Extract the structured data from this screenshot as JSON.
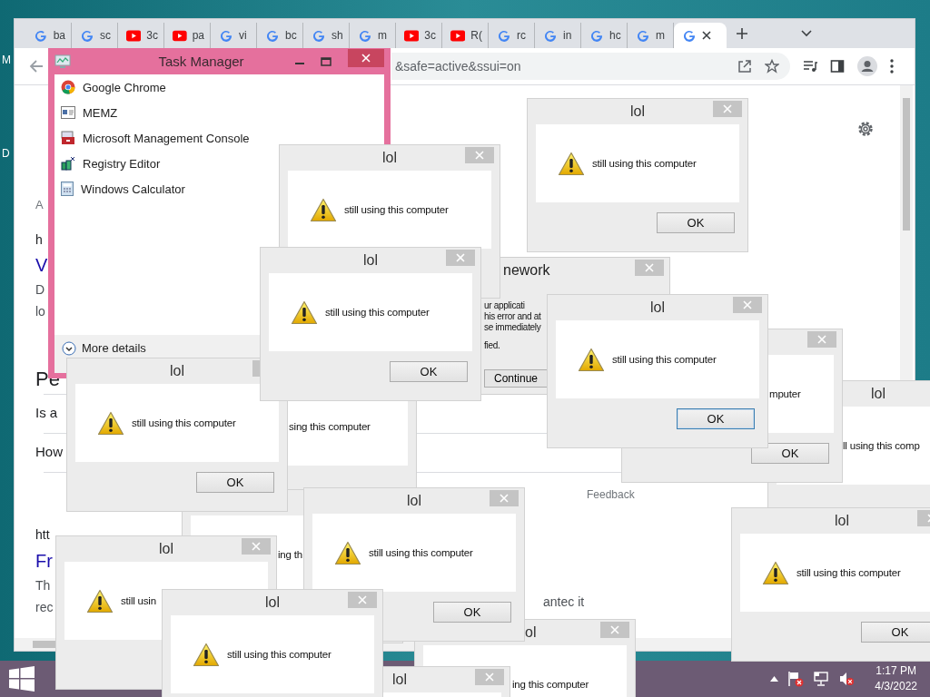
{
  "desktop": {
    "icon_labels": [
      "M",
      "D"
    ]
  },
  "browser": {
    "tabs": [
      {
        "label": "ba",
        "kind": "google",
        "selected": false
      },
      {
        "label": "sc",
        "kind": "google",
        "selected": false
      },
      {
        "label": "3c",
        "kind": "video",
        "selected": false
      },
      {
        "label": "pa",
        "kind": "video",
        "selected": false
      },
      {
        "label": "vi",
        "kind": "google",
        "selected": false
      },
      {
        "label": "bc",
        "kind": "google",
        "selected": false
      },
      {
        "label": "sh",
        "kind": "google",
        "selected": false
      },
      {
        "label": "m",
        "kind": "google",
        "selected": false
      },
      {
        "label": "3c",
        "kind": "video",
        "selected": false
      },
      {
        "label": "R(",
        "kind": "video",
        "selected": false
      },
      {
        "label": "rc",
        "kind": "google",
        "selected": false
      },
      {
        "label": "in",
        "kind": "google",
        "selected": false
      },
      {
        "label": "hc",
        "kind": "google",
        "selected": false
      },
      {
        "label": "m",
        "kind": "google",
        "selected": false
      },
      {
        "kind": "google",
        "selected": true
      }
    ],
    "address": "&safe=active&ssui=on",
    "page": {
      "fragments": [
        {
          "kind": "meta",
          "text": "A"
        },
        {
          "kind": "url",
          "text": "h"
        },
        {
          "kind": "title",
          "text": "V"
        },
        {
          "kind": "snippet",
          "text": "D"
        },
        {
          "kind": "snippet",
          "text": "lo"
        },
        {
          "kind": "heading",
          "text": "Pe"
        },
        {
          "kind": "question",
          "text": "Is a"
        },
        {
          "kind": "question",
          "text": "How"
        },
        {
          "kind": "url",
          "text": "htt"
        },
        {
          "kind": "title",
          "text": "Fr"
        },
        {
          "kind": "snippet",
          "text": "Th"
        },
        {
          "kind": "snippet",
          "text": "rec"
        }
      ],
      "feedback": "Feedback",
      "snippet_tail": "antec it"
    }
  },
  "task_manager": {
    "title": "Task Manager",
    "apps": [
      {
        "name": "Google Chrome",
        "kind": "chrome"
      },
      {
        "name": "MEMZ",
        "kind": "app"
      },
      {
        "name": "Microsoft Management Console",
        "kind": "console"
      },
      {
        "name": "Registry Editor",
        "kind": "registry"
      },
      {
        "name": "Windows Calculator",
        "kind": "calculator"
      }
    ],
    "more_details": "More details"
  },
  "error_dialog": {
    "title": "nework",
    "paragraphs": [
      [
        "ur applicati",
        "his error and at",
        "se immediately"
      ],
      [
        "fied."
      ]
    ],
    "button": "Continue"
  },
  "dialogs": [
    {
      "title": "lol",
      "message": "still using this computer",
      "icon": true,
      "button": "OK",
      "focused": false
    },
    {
      "title": "lol",
      "message": "still using this computer",
      "icon": true
    },
    {
      "title": "lol",
      "message": "still using this computer",
      "icon": true,
      "button": "OK",
      "focused": false
    },
    {
      "title": "lol",
      "message": "still using this computer",
      "icon": true,
      "button": "OK",
      "focused": false
    },
    {
      "message": "sing this computer",
      "icon": false
    },
    {
      "title": "lol",
      "message": "still using this computer",
      "icon": true,
      "button": "OK",
      "focused": true
    },
    {
      "message": "mputer",
      "icon": false,
      "button": "OK",
      "focused": false
    },
    {
      "title": "lol",
      "message": "ll using this comp",
      "icon": false
    },
    {
      "title": "lol",
      "message": "still usin",
      "icon": true
    },
    {
      "message": "ing th",
      "icon": false
    },
    {
      "title": "lol",
      "message": "still using this computer",
      "icon": true,
      "button": "OK",
      "focused": false
    },
    {
      "title": "lol",
      "message": "still using this computer",
      "icon": true,
      "button": "OK",
      "focused": false
    },
    {
      "title": "lol",
      "message": "still using this computer",
      "icon": true
    },
    {
      "title": "lol"
    },
    {
      "title": "ol",
      "message": "ing this computer",
      "icon": false
    }
  ],
  "taskbar": {
    "time": "1:17 PM",
    "date": "4/3/2022"
  }
}
